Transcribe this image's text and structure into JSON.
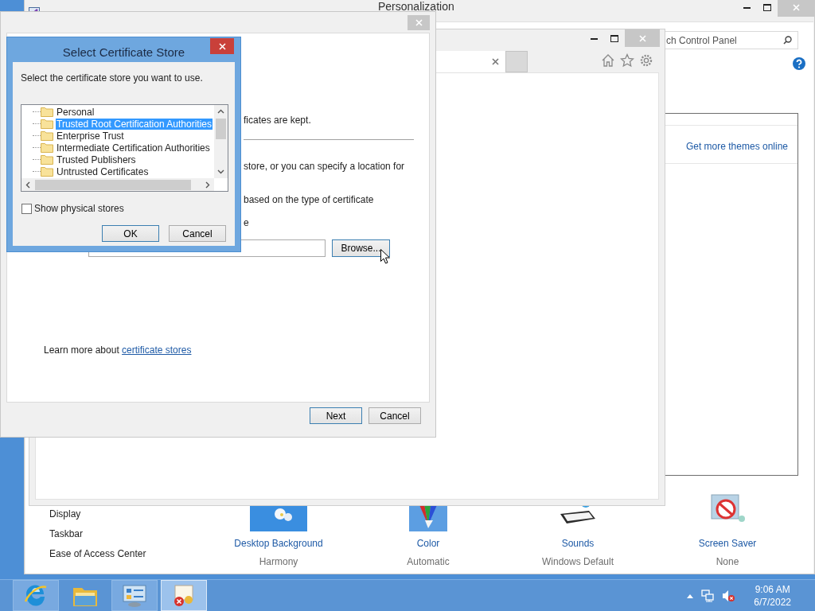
{
  "personalization_window": {
    "title": "Personalization",
    "search": {
      "value": "ch Control Panel"
    },
    "themes_link": "Get more themes online",
    "see_also": [
      "Display",
      "Taskbar",
      "Ease of Access Center"
    ],
    "settings": [
      {
        "kind": "wallpaper",
        "label": "Desktop Background",
        "value": "Harmony"
      },
      {
        "kind": "color",
        "label": "Color",
        "value": "Automatic"
      },
      {
        "kind": "sounds",
        "label": "Sounds",
        "value": "Windows Default"
      },
      {
        "kind": "screensaver",
        "label": "Screen Saver",
        "value": "None"
      }
    ]
  },
  "import_wizard": {
    "lines": [
      "ficates are kept.",
      "store, or you can specify a location for",
      "based on the type of certificate",
      "e"
    ],
    "browse_button": {
      "label": "Browse...",
      "default": true
    },
    "learn_more": {
      "text": "Learn more about",
      "link": "certificate stores"
    },
    "buttons": [
      {
        "label": "Next",
        "default": true
      },
      {
        "label": "Cancel",
        "default": false
      }
    ]
  },
  "dialog": {
    "title": "Select Certificate Store",
    "prompt": "Select the certificate store you want to use.",
    "stores": [
      {
        "label": "Personal",
        "selected": false
      },
      {
        "label": "Trusted Root Certification Authorities",
        "selected": true
      },
      {
        "label": "Enterprise Trust",
        "selected": false
      },
      {
        "label": "Intermediate Certification Authorities",
        "selected": false
      },
      {
        "label": "Trusted Publishers",
        "selected": false
      },
      {
        "label": "Untrusted Certificates",
        "selected": false
      }
    ],
    "show_physical_stores": {
      "label": "Show physical stores",
      "checked": false
    },
    "buttons": [
      {
        "label": "OK",
        "default": true
      },
      {
        "label": "Cancel",
        "default": false
      }
    ]
  },
  "taskbar": {
    "apps": [
      {
        "kind": "browser",
        "running": true,
        "active": false
      },
      {
        "kind": "explorer",
        "running": false,
        "active": false
      },
      {
        "kind": "control-panel",
        "running": true,
        "active": false
      },
      {
        "kind": "certificate",
        "running": true,
        "active": true
      }
    ],
    "clock": {
      "time": "9:06 AM",
      "date": "6/7/2022"
    }
  }
}
